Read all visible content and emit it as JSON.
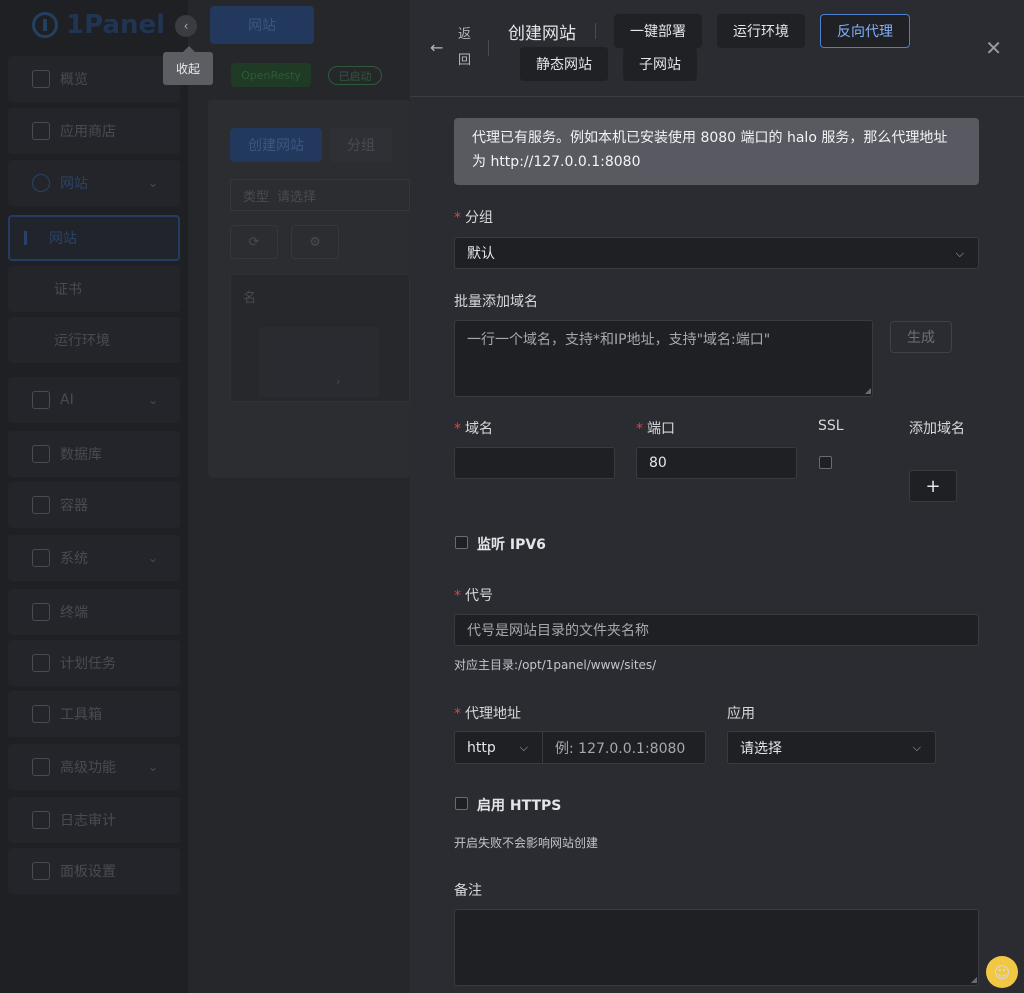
{
  "sidebar": {
    "logo_text": "1Panel",
    "collapse_tooltip": "收起",
    "items": [
      {
        "label": "概览"
      },
      {
        "label": "应用商店"
      },
      {
        "label": "网站"
      },
      {
        "label": "网站"
      },
      {
        "label": "证书"
      },
      {
        "label": "运行环境"
      },
      {
        "label": "AI"
      },
      {
        "label": "数据库"
      },
      {
        "label": "容器"
      },
      {
        "label": "系统"
      },
      {
        "label": "终端"
      },
      {
        "label": "计划任务"
      },
      {
        "label": "工具箱"
      },
      {
        "label": "高级功能"
      },
      {
        "label": "日志审计"
      },
      {
        "label": "面板设置"
      }
    ]
  },
  "background": {
    "top_button": "网站",
    "openresty_tag": "OpenResty",
    "running_tag": "已启动",
    "create_button": "创建网站",
    "group_button": "分组",
    "filter_label": "类型",
    "filter_placeholder": "请选择",
    "table_header": "名",
    "table_arrow": "›"
  },
  "drawer": {
    "back_label": "返回",
    "title": "创建网站",
    "tabs": [
      "一键部署",
      "运行环境",
      "反向代理",
      "静态网站",
      "子网站"
    ],
    "active_tab": "反向代理",
    "alert": "代理已有服务。例如本机已安装使用 8080 端口的 halo 服务，那么代理地址为 http://127.0.0.1:8080",
    "form": {
      "group_label": "分组",
      "group_value": "默认",
      "batch_domain_label": "批量添加域名",
      "batch_domain_placeholder": "一行一个域名，支持*和IP地址，支持\"域名:端口\"",
      "generate_button": "生成",
      "domain_label": "域名",
      "domain_value": "",
      "port_label": "端口",
      "port_value": "80",
      "ssl_label": "SSL",
      "add_domain_label": "添加域名",
      "add_domain_button": "+",
      "ipv6_label": "监听 IPV6",
      "alias_label": "代号",
      "alias_placeholder": "代号是网站目录的文件夹名称",
      "alias_hint": "对应主目录:/opt/1panel/www/sites/",
      "proxy_label": "代理地址",
      "proxy_protocol": "http",
      "proxy_placeholder": "例: 127.0.0.1:8080",
      "app_label": "应用",
      "app_placeholder": "请选择",
      "https_label": "启用 HTTPS",
      "https_hint": "开启失败不会影响网站创建",
      "remark_label": "备注",
      "remark_value": ""
    }
  },
  "colors": {
    "accent": "#4a7fd1",
    "required": "#d9483f",
    "drawer_bg": "#2b2c31"
  }
}
